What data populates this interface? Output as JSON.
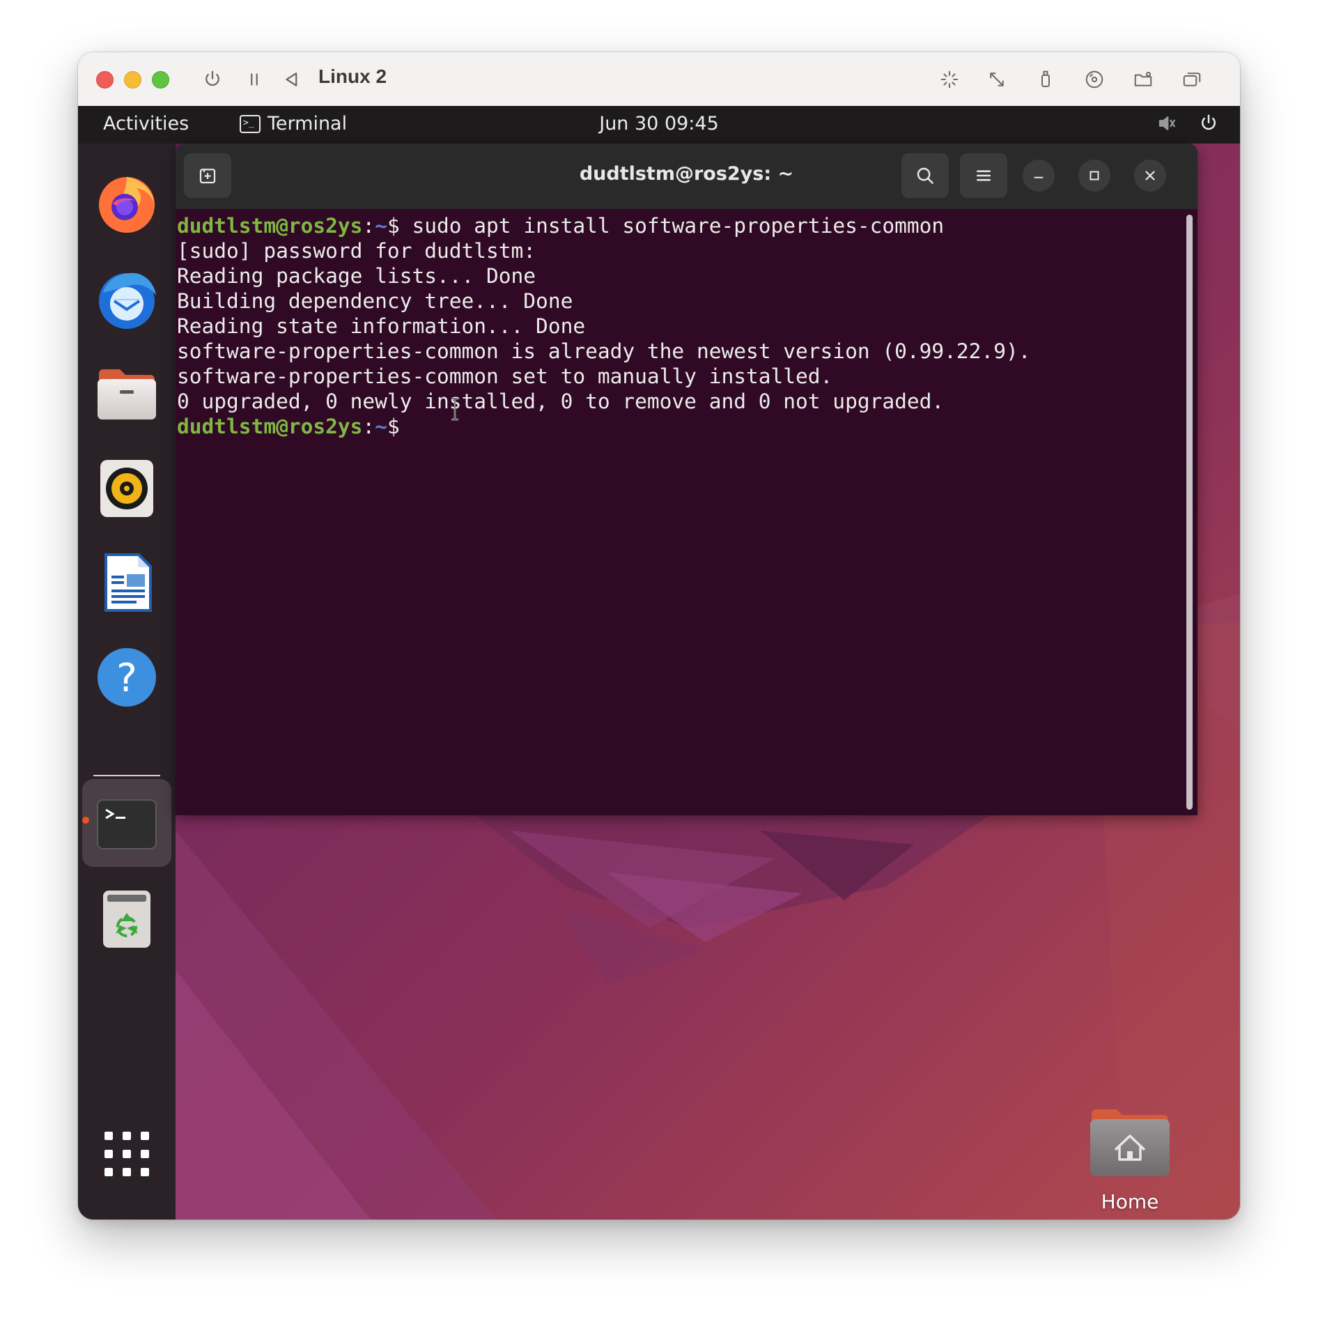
{
  "vm_window": {
    "title": "Linux 2",
    "toolbar_icons": [
      "power-icon",
      "pause-icon",
      "back-icon",
      "sparkle-icon",
      "resize-icon",
      "usb-icon",
      "disc-icon",
      "shared-folder-icon",
      "windows-icon"
    ]
  },
  "gnome_topbar": {
    "activities": "Activities",
    "app_name": "Terminal",
    "clock": "Jun 30  09:45",
    "tray_icons": [
      "speaker-muted-icon",
      "power-icon"
    ]
  },
  "dock": {
    "apps": [
      "firefox",
      "thunderbird",
      "files",
      "rhythmbox",
      "libreoffice-writer",
      "help",
      "terminal",
      "trash",
      "show-applications"
    ],
    "active_app": "terminal"
  },
  "terminal": {
    "title": "dudtlstm@ros2ys: ~",
    "prompt": {
      "user_host": "dudtlstm@ros2ys",
      "sep": ":",
      "path": "~",
      "symbol": "$"
    },
    "command": " sudo apt install software-properties-common",
    "output_lines": [
      "[sudo] password for dudtlstm:",
      "Reading package lists... Done",
      "Building dependency tree... Done",
      "Reading state information... Done",
      "software-properties-common is already the newest version (0.99.22.9).",
      "software-properties-common set to manually installed.",
      "0 upgraded, 0 newly installed, 0 to remove and 0 not upgraded."
    ]
  },
  "desktop": {
    "home_label": "Home"
  },
  "colors": {
    "terminal_bg": "#300a24",
    "prompt_user": "#7fb842",
    "prompt_path": "#5a7fcf",
    "accent": "#e95420"
  }
}
